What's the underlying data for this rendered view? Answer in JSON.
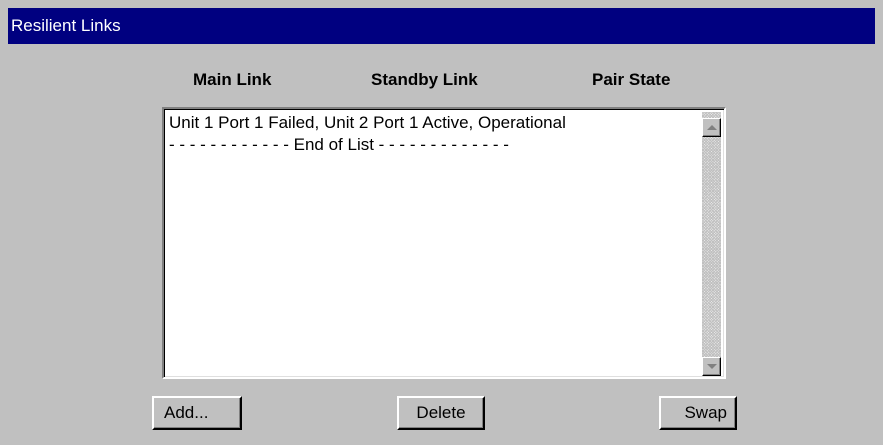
{
  "window": {
    "title": "Resilient Links"
  },
  "columns": {
    "main_link": "Main Link",
    "standby_link": "Standby Link",
    "pair_state": "Pair State"
  },
  "list": {
    "items": [
      "Unit 1 Port 1 Failed, Unit 2 Port 1 Active, Operational",
      "- - - - - - - - - - - - End of List - - - - - - - - - - - - -"
    ]
  },
  "buttons": {
    "add": "Add...",
    "delete": "Delete",
    "swap": "Swap"
  },
  "colors": {
    "titlebar": "#000080",
    "background": "#c0c0c0",
    "list_background": "#ffffff"
  },
  "icons": {
    "scroll_up": "scroll-up-arrow-icon",
    "scroll_down": "scroll-down-arrow-icon"
  }
}
